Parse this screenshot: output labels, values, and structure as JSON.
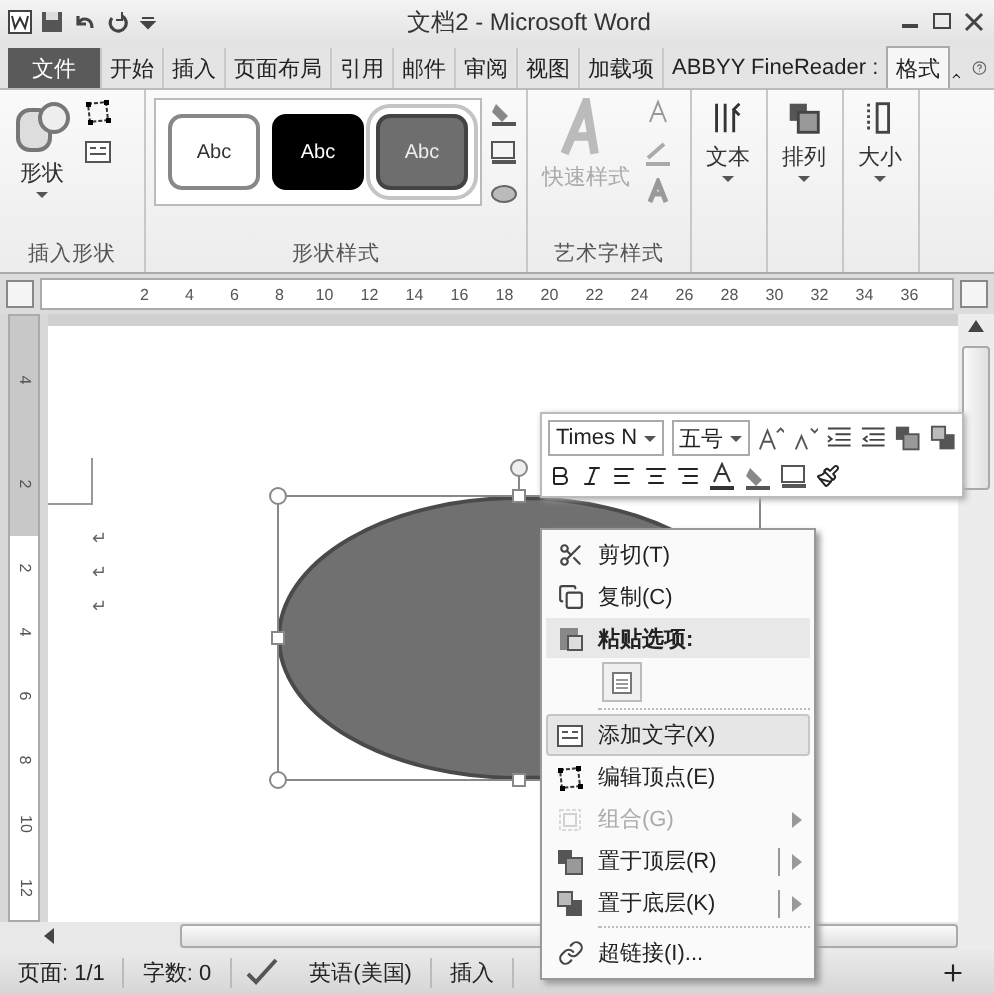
{
  "window": {
    "title": "文档2 - Microsoft Word"
  },
  "tabs": [
    {
      "label": "文件",
      "kind": "file",
      "selected": false
    },
    {
      "label": "开始",
      "kind": "tab",
      "selected": false
    },
    {
      "label": "插入",
      "kind": "tab",
      "selected": false
    },
    {
      "label": "页面布局",
      "kind": "tab",
      "selected": false
    },
    {
      "label": "引用",
      "kind": "tab",
      "selected": false
    },
    {
      "label": "邮件",
      "kind": "tab",
      "selected": false
    },
    {
      "label": "审阅",
      "kind": "tab",
      "selected": false
    },
    {
      "label": "视图",
      "kind": "tab",
      "selected": false
    },
    {
      "label": "加载项",
      "kind": "tab",
      "selected": false
    },
    {
      "label": "ABBYY FineReader :",
      "kind": "tab",
      "selected": false
    },
    {
      "label": "格式",
      "kind": "tab",
      "selected": true
    }
  ],
  "ribbon": {
    "insert_shapes": {
      "title": "插入形状",
      "shape_button": "形状"
    },
    "shape_styles": {
      "title": "形状样式",
      "styles": [
        {
          "label": "Abc",
          "kind": "outline",
          "selected": false
        },
        {
          "label": "Abc",
          "kind": "dark",
          "selected": false
        },
        {
          "label": "Abc",
          "kind": "gray",
          "selected": true
        }
      ]
    },
    "wordart_styles": {
      "title": "艺术字样式",
      "quick_styles": "快速样式",
      "quick_styles_disabled": true
    },
    "large_buttons": [
      {
        "label": "文本",
        "kind": "text"
      },
      {
        "label": "排列",
        "kind": "arrange"
      },
      {
        "label": "大小",
        "kind": "size"
      }
    ]
  },
  "ruler": {
    "labels": [
      "2",
      "4",
      "6",
      "8",
      "10",
      "12",
      "14",
      "16",
      "18",
      "20",
      "22",
      "24",
      "26",
      "28",
      "30",
      "32",
      "34",
      "36"
    ]
  },
  "vertical_ruler": {
    "top_labels": [
      "4",
      "2"
    ],
    "bottom_labels": [
      "2",
      "4",
      "6",
      "8",
      "10",
      "12"
    ]
  },
  "document": {
    "paragraph_marks": [
      "↵",
      "↵",
      "↵"
    ]
  },
  "mini_toolbar": {
    "font": "Times N",
    "size": "五号"
  },
  "context_menu": {
    "items": [
      {
        "kind": "item",
        "label": "剪切(T)",
        "disabled": false,
        "selected": false,
        "submenu": false,
        "split": false
      },
      {
        "kind": "item",
        "label": "复制(C)",
        "disabled": false,
        "selected": false,
        "submenu": false,
        "split": false
      },
      {
        "kind": "header",
        "label": "粘贴选项:"
      },
      {
        "kind": "paste_option"
      },
      {
        "kind": "item",
        "label": "添加文字(X)",
        "disabled": false,
        "selected": true,
        "submenu": false,
        "split": false
      },
      {
        "kind": "item",
        "label": "编辑顶点(E)",
        "disabled": false,
        "selected": false,
        "submenu": false,
        "split": false
      },
      {
        "kind": "item",
        "label": "组合(G)",
        "disabled": true,
        "selected": false,
        "submenu": true,
        "split": false
      },
      {
        "kind": "item",
        "label": "置于顶层(R)",
        "disabled": false,
        "selected": false,
        "submenu": true,
        "split": true
      },
      {
        "kind": "item",
        "label": "置于底层(K)",
        "disabled": false,
        "selected": false,
        "submenu": true,
        "split": true
      },
      {
        "kind": "item",
        "label": "超链接(I)...",
        "disabled": false,
        "selected": false,
        "submenu": false,
        "split": false
      }
    ]
  },
  "status_bar": {
    "page": "页面: 1/1",
    "words": "字数: 0",
    "language": "英语(美国)",
    "mode": "插入"
  }
}
